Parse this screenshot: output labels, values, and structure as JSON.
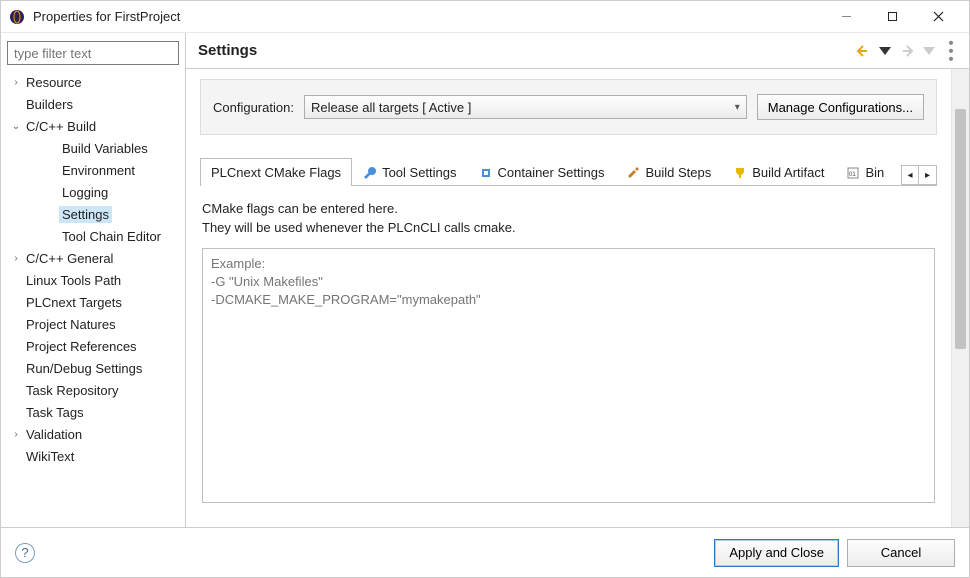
{
  "window": {
    "title": "Properties for FirstProject"
  },
  "filter": {
    "placeholder": "type filter text"
  },
  "tree": [
    {
      "label": "Resource",
      "expandable": true,
      "expanded": false,
      "indent": 0
    },
    {
      "label": "Builders",
      "expandable": false,
      "indent": 0
    },
    {
      "label": "C/C++ Build",
      "expandable": true,
      "expanded": true,
      "indent": 0
    },
    {
      "label": "Build Variables",
      "expandable": false,
      "indent": 1,
      "parent": "C/C++ Build"
    },
    {
      "label": "Environment",
      "expandable": false,
      "indent": 1,
      "parent": "C/C++ Build"
    },
    {
      "label": "Logging",
      "expandable": false,
      "indent": 1,
      "parent": "C/C++ Build"
    },
    {
      "label": "Settings",
      "expandable": false,
      "indent": 1,
      "parent": "C/C++ Build",
      "selected": true
    },
    {
      "label": "Tool Chain Editor",
      "expandable": false,
      "indent": 1,
      "parent": "C/C++ Build"
    },
    {
      "label": "C/C++ General",
      "expandable": true,
      "expanded": false,
      "indent": 0
    },
    {
      "label": "Linux Tools Path",
      "expandable": false,
      "indent": 0
    },
    {
      "label": "PLCnext Targets",
      "expandable": false,
      "indent": 0
    },
    {
      "label": "Project Natures",
      "expandable": false,
      "indent": 0
    },
    {
      "label": "Project References",
      "expandable": false,
      "indent": 0
    },
    {
      "label": "Run/Debug Settings",
      "expandable": false,
      "indent": 0
    },
    {
      "label": "Task Repository",
      "expandable": false,
      "indent": 0
    },
    {
      "label": "Task Tags",
      "expandable": false,
      "indent": 0
    },
    {
      "label": "Validation",
      "expandable": true,
      "expanded": false,
      "indent": 0
    },
    {
      "label": "WikiText",
      "expandable": false,
      "indent": 0
    }
  ],
  "page": {
    "title": "Settings",
    "config_label": "Configuration:",
    "config_value": "Release all targets  [ Active ]",
    "manage_config": "Manage Configurations..."
  },
  "tabs": [
    {
      "label": "PLCnext CMake Flags",
      "icon": "",
      "active": true
    },
    {
      "label": "Tool Settings",
      "icon": "wrench"
    },
    {
      "label": "Container Settings",
      "icon": "chip"
    },
    {
      "label": "Build Steps",
      "icon": "hammer"
    },
    {
      "label": "Build Artifact",
      "icon": "trophy"
    },
    {
      "label": "Bin",
      "icon": "binary",
      "truncated": true
    }
  ],
  "cmake": {
    "desc1": "CMake flags can be entered here.",
    "desc2": "They will be used whenever the PLCnCLI calls cmake.",
    "placeholder": "Example:\n-G \"Unix Makefiles\"\n-DCMAKE_MAKE_PROGRAM=\"mymakepath\""
  },
  "buttons": {
    "apply_close": "Apply and Close",
    "cancel": "Cancel"
  }
}
